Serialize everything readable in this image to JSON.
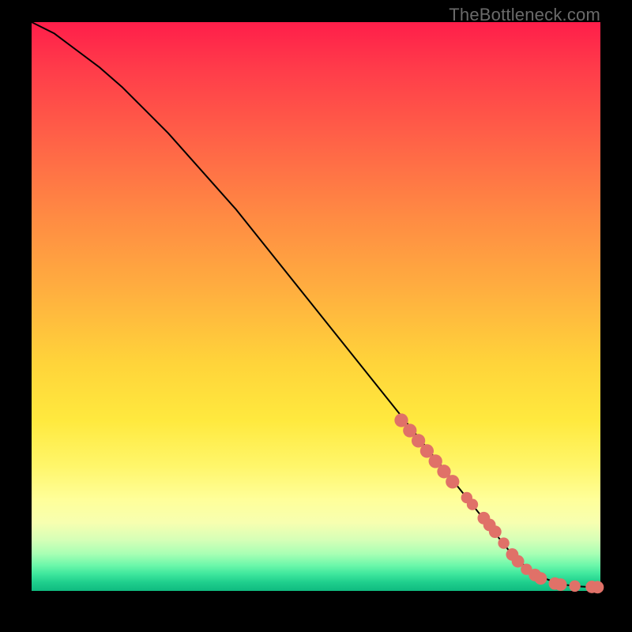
{
  "watermark": "TheBottleneck.com",
  "colors": {
    "marker": "#e07168",
    "curve": "#000000",
    "frame_border": "#000000"
  },
  "chart_data": {
    "type": "line",
    "title": "",
    "xlabel": "",
    "ylabel": "",
    "xlim": [
      0,
      100
    ],
    "ylim": [
      0,
      100
    ],
    "grid": false,
    "legend": false,
    "series": [
      {
        "name": "curve",
        "x": [
          0,
          4,
          8,
          12,
          16,
          20,
          24,
          28,
          32,
          36,
          40,
          44,
          48,
          52,
          56,
          60,
          64,
          68,
          72,
          76,
          80,
          84,
          86,
          88,
          90,
          92,
          94,
          96,
          98,
          100
        ],
        "y": [
          100,
          98,
          95,
          92,
          88.5,
          84.5,
          80.5,
          76,
          71.5,
          67,
          62,
          57,
          52,
          47,
          42,
          37,
          32,
          27,
          22,
          17,
          12,
          7,
          5,
          3.4,
          2.3,
          1.5,
          1.05,
          0.8,
          0.7,
          0.6
        ]
      }
    ],
    "markers": [
      {
        "x": 65.0,
        "y": 30.0,
        "r": 1.2
      },
      {
        "x": 66.5,
        "y": 28.2,
        "r": 1.2
      },
      {
        "x": 68.0,
        "y": 26.4,
        "r": 1.2
      },
      {
        "x": 69.5,
        "y": 24.6,
        "r": 1.2
      },
      {
        "x": 71.0,
        "y": 22.8,
        "r": 1.2
      },
      {
        "x": 72.5,
        "y": 21.0,
        "r": 1.2
      },
      {
        "x": 74.0,
        "y": 19.2,
        "r": 1.2
      },
      {
        "x": 76.5,
        "y": 16.4,
        "r": 1.0
      },
      {
        "x": 77.5,
        "y": 15.2,
        "r": 1.0
      },
      {
        "x": 79.5,
        "y": 12.8,
        "r": 1.1
      },
      {
        "x": 80.5,
        "y": 11.6,
        "r": 1.1
      },
      {
        "x": 81.5,
        "y": 10.4,
        "r": 1.1
      },
      {
        "x": 83.0,
        "y": 8.4,
        "r": 1.0
      },
      {
        "x": 84.5,
        "y": 6.4,
        "r": 1.1
      },
      {
        "x": 85.5,
        "y": 5.2,
        "r": 1.1
      },
      {
        "x": 87.0,
        "y": 3.8,
        "r": 1.0
      },
      {
        "x": 88.5,
        "y": 2.8,
        "r": 1.1
      },
      {
        "x": 89.5,
        "y": 2.2,
        "r": 1.1
      },
      {
        "x": 92.0,
        "y": 1.3,
        "r": 1.1
      },
      {
        "x": 93.0,
        "y": 1.1,
        "r": 1.1
      },
      {
        "x": 95.5,
        "y": 0.85,
        "r": 1.0
      },
      {
        "x": 98.5,
        "y": 0.7,
        "r": 1.1
      },
      {
        "x": 99.5,
        "y": 0.65,
        "r": 1.1
      }
    ]
  }
}
